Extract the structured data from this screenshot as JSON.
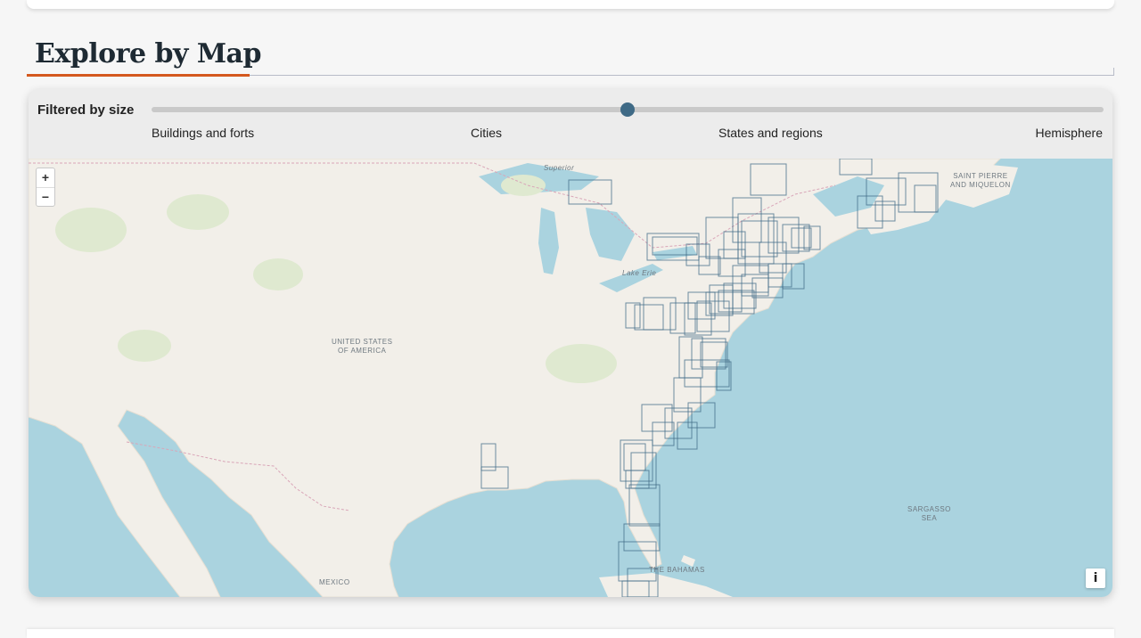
{
  "section": {
    "title": "Explore by Map"
  },
  "filter": {
    "label": "Filtered by size",
    "slider_value_fraction": 0.5,
    "ticks": [
      "Buildings and forts",
      "Cities",
      "States and regions",
      "Hemisphere"
    ]
  },
  "map": {
    "labels": {
      "usa": "UNITED STATES\nOF AMERICA",
      "mexico": "MEXICO",
      "bahamas": "THE BAHAMAS",
      "sargasso": "SARGASSO\nSEA",
      "saint_pierre": "SAINT PIERRE\nAND MIQUELON",
      "superior": "Superior",
      "erie": "Lake Erie"
    },
    "colors": {
      "water": "#aad3df",
      "land": "#f2efe9",
      "park": "#dfe9d0",
      "border": "#d9a6b8",
      "footprint": "#3f6a86"
    }
  },
  "controls": {
    "zoom_in": "+",
    "zoom_out": "−",
    "info": "i"
  }
}
